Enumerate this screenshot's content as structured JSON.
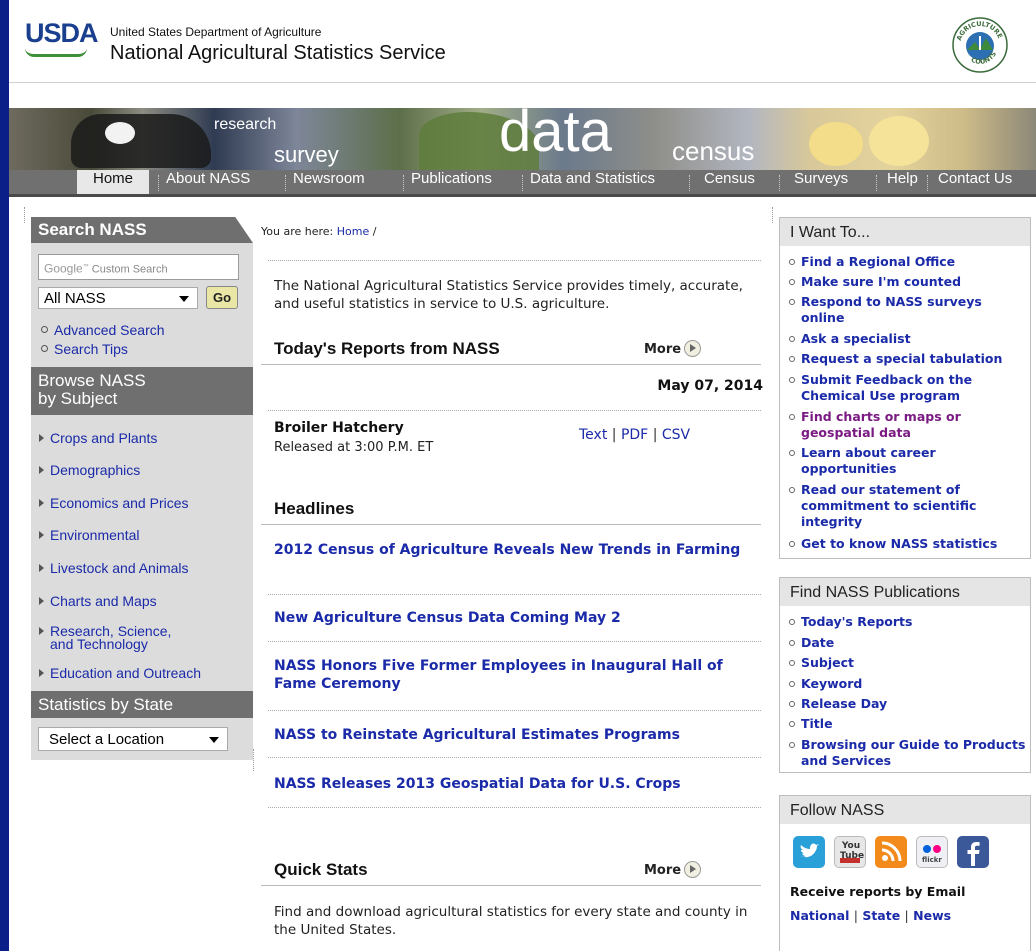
{
  "header": {
    "logo_text": "USDA",
    "department": "United States Department of Agriculture",
    "agency": "National Agricultural Statistics Service",
    "seal_top": "AGRICULTURE",
    "seal_bottom": "COUNTS"
  },
  "banner": {
    "words": [
      "research",
      "survey",
      "data",
      "census"
    ]
  },
  "nav": {
    "items": [
      "Home",
      "About NASS",
      "Newsroom",
      "Publications",
      "Data and Statistics",
      "Census",
      "Surveys",
      "Help",
      "Contact Us"
    ],
    "selected": "Home"
  },
  "search": {
    "heading": "Search NASS",
    "placeholder_brand": "Google",
    "placeholder_text": "Custom Search",
    "scope_value": "All NASS",
    "go_label": "Go",
    "links": [
      "Advanced Search",
      "Search Tips"
    ]
  },
  "browse": {
    "heading_line1": "Browse NASS",
    "heading_line2": "by Subject",
    "subjects": [
      "Crops and Plants",
      "Demographics",
      "Economics and Prices",
      "Environmental",
      "Livestock and Animals",
      "Charts and Maps",
      "Research, Science,",
      "and Technology",
      "Education and Outreach"
    ]
  },
  "state": {
    "heading": "Statistics by State",
    "select_value": "Select a Location"
  },
  "main": {
    "breadcrumb_label": "You are here:",
    "breadcrumb_home": "Home",
    "breadcrumb_sep": "/",
    "intro": "The National Agricultural Statistics Service provides timely, accurate, and useful statistics in service to U.S. agriculture.",
    "reports_title": "Today's Reports from NASS",
    "more_label": "More",
    "report_date": "May 07, 2014",
    "report": {
      "name": "Broiler Hatchery",
      "time": "Released at 3:00 P.M. ET",
      "formats": [
        "Text",
        "PDF",
        "CSV"
      ],
      "format_sep": "|"
    },
    "headlines_title": "Headlines",
    "headlines": [
      "2012 Census of Agriculture Reveals New Trends in Farming",
      "New Agriculture Census Data Coming May 2",
      "NASS Honors Five Former Employees in Inaugural Hall of Fame Ceremony",
      "NASS to Reinstate Agricultural Estimates Programs",
      "NASS Releases 2013 Geospatial Data for U.S. Crops"
    ],
    "quickstats_title": "Quick Stats",
    "quickstats_text": "Find and download agricultural statistics for every state and county in the United States."
  },
  "want": {
    "heading": "I Want To...",
    "links": [
      "Find a Regional Office",
      "Make sure I'm counted",
      "Respond to NASS surveys online",
      "Ask a specialist",
      "Request a special tabulation",
      "Submit Feedback on the Chemical Use program",
      "Find charts or maps or geospatial data",
      "Learn about career opportunities",
      "Read our statement of commitment to scientific integrity",
      "Get to know NASS statistics"
    ]
  },
  "publications": {
    "heading": "Find NASS Publications",
    "links": [
      "Today's Reports",
      "Date",
      "Subject",
      "Keyword",
      "Release Day",
      "Title",
      "Browsing our Guide to Products and Services"
    ]
  },
  "follow": {
    "heading": "Follow NASS",
    "icons": [
      "twitter-icon",
      "youtube-icon",
      "rss-icon",
      "flickr-icon",
      "facebook-icon"
    ],
    "youtube_text": "You Tube",
    "flickr_text": "flickr",
    "email_label": "Receive reports by Email",
    "email_links": [
      "National",
      "State",
      "News"
    ],
    "email_sep": "|"
  },
  "colors": {
    "page_bg": "#0b1f88",
    "link": "#1a2aa8",
    "visited": "#7a1a82",
    "nav_bg": "#707070"
  }
}
